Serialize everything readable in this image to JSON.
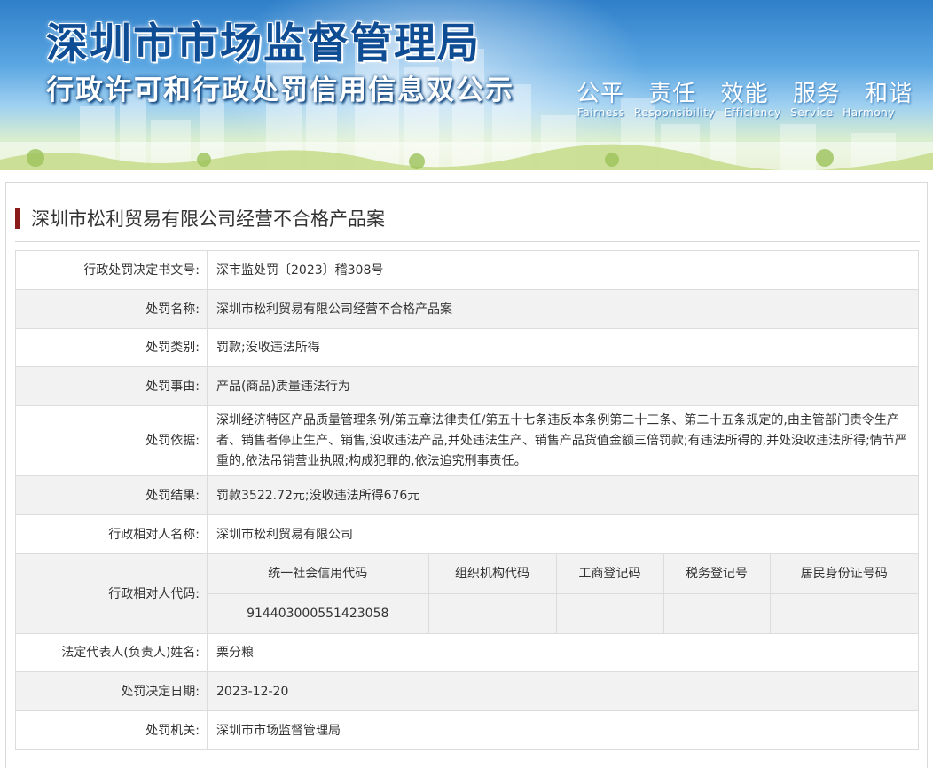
{
  "banner": {
    "title": "深圳市市场监督管理局",
    "subtitle": "行政许可和行政处罚信用信息双公示",
    "slogan_cn": [
      "公平",
      "责任",
      "效能",
      "服务",
      "和谐"
    ],
    "slogan_en": [
      "Fairness",
      "Responsibility",
      "Efficiency",
      "Service",
      "Harmony"
    ]
  },
  "case": {
    "title": "深圳市松利贸易有限公司经营不合格产品案"
  },
  "rows": [
    {
      "label": "行政处罚决定书文号:",
      "value": "深市监处罚〔2023〕稽308号"
    },
    {
      "label": "处罚名称:",
      "value": "深圳市松利贸易有限公司经营不合格产品案"
    },
    {
      "label": "处罚类别:",
      "value": "罚款;没收违法所得"
    },
    {
      "label": "处罚事由:",
      "value": "产品(商品)质量违法行为"
    },
    {
      "label": "处罚依据:",
      "value": "深圳经济特区产品质量管理条例/第五章法律责任/第五十七条违反本条例第二十三条、第二十五条规定的,由主管部门责令生产者、销售者停止生产、销售,没收违法产品,并处违法生产、销售产品货值金额三倍罚款;有违法所得的,并处没收违法所得;情节严重的,依法吊销营业执照;构成犯罪的,依法追究刑事责任。"
    },
    {
      "label": "处罚结果:",
      "value": "罚款3522.72元;没收违法所得676元"
    },
    {
      "label": "行政相对人名称:",
      "value": "深圳市松利贸易有限公司"
    }
  ],
  "codes": {
    "label": "行政相对人代码:",
    "headers": [
      "统一社会信用代码",
      "组织机构代码",
      "工商登记码",
      "税务登记号",
      "居民身份证号码"
    ],
    "values": [
      "914403000551423058",
      "",
      "",
      "",
      ""
    ]
  },
  "rows_after": [
    {
      "label": "法定代表人(负责人)姓名:",
      "value": "栗分粮"
    },
    {
      "label": "处罚决定日期:",
      "value": "2023-12-20"
    },
    {
      "label": "处罚机关:",
      "value": "深圳市市场监督管理局"
    }
  ],
  "colors": {
    "title_bar": "#8b1b1b",
    "banner_title": "#0e4c94",
    "row_alt": "#f2f2f2",
    "border": "#dcdcdc"
  }
}
